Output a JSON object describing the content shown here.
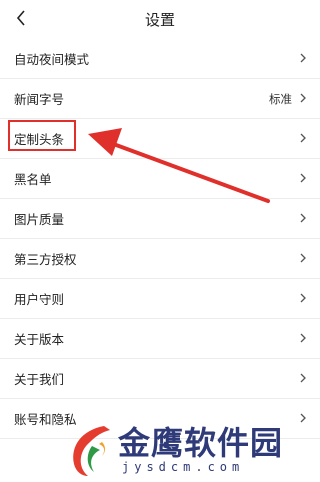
{
  "header": {
    "title": "设置",
    "back_icon": "chevron-left-icon"
  },
  "settings": {
    "items": [
      {
        "label": "自动夜间模式",
        "value": ""
      },
      {
        "label": "新闻字号",
        "value": "标准"
      },
      {
        "label": "定制头条",
        "value": ""
      },
      {
        "label": "黑名单",
        "value": ""
      },
      {
        "label": "图片质量",
        "value": ""
      },
      {
        "label": "第三方授权",
        "value": ""
      },
      {
        "label": "用户守则",
        "value": ""
      },
      {
        "label": "关于版本",
        "value": ""
      },
      {
        "label": "关于我们",
        "value": ""
      },
      {
        "label": "账号和隐私",
        "value": ""
      }
    ]
  },
  "annotation": {
    "color": "#e0302c"
  },
  "watermark": {
    "text": "金鹰软件园",
    "url": "jysdcm.com"
  }
}
